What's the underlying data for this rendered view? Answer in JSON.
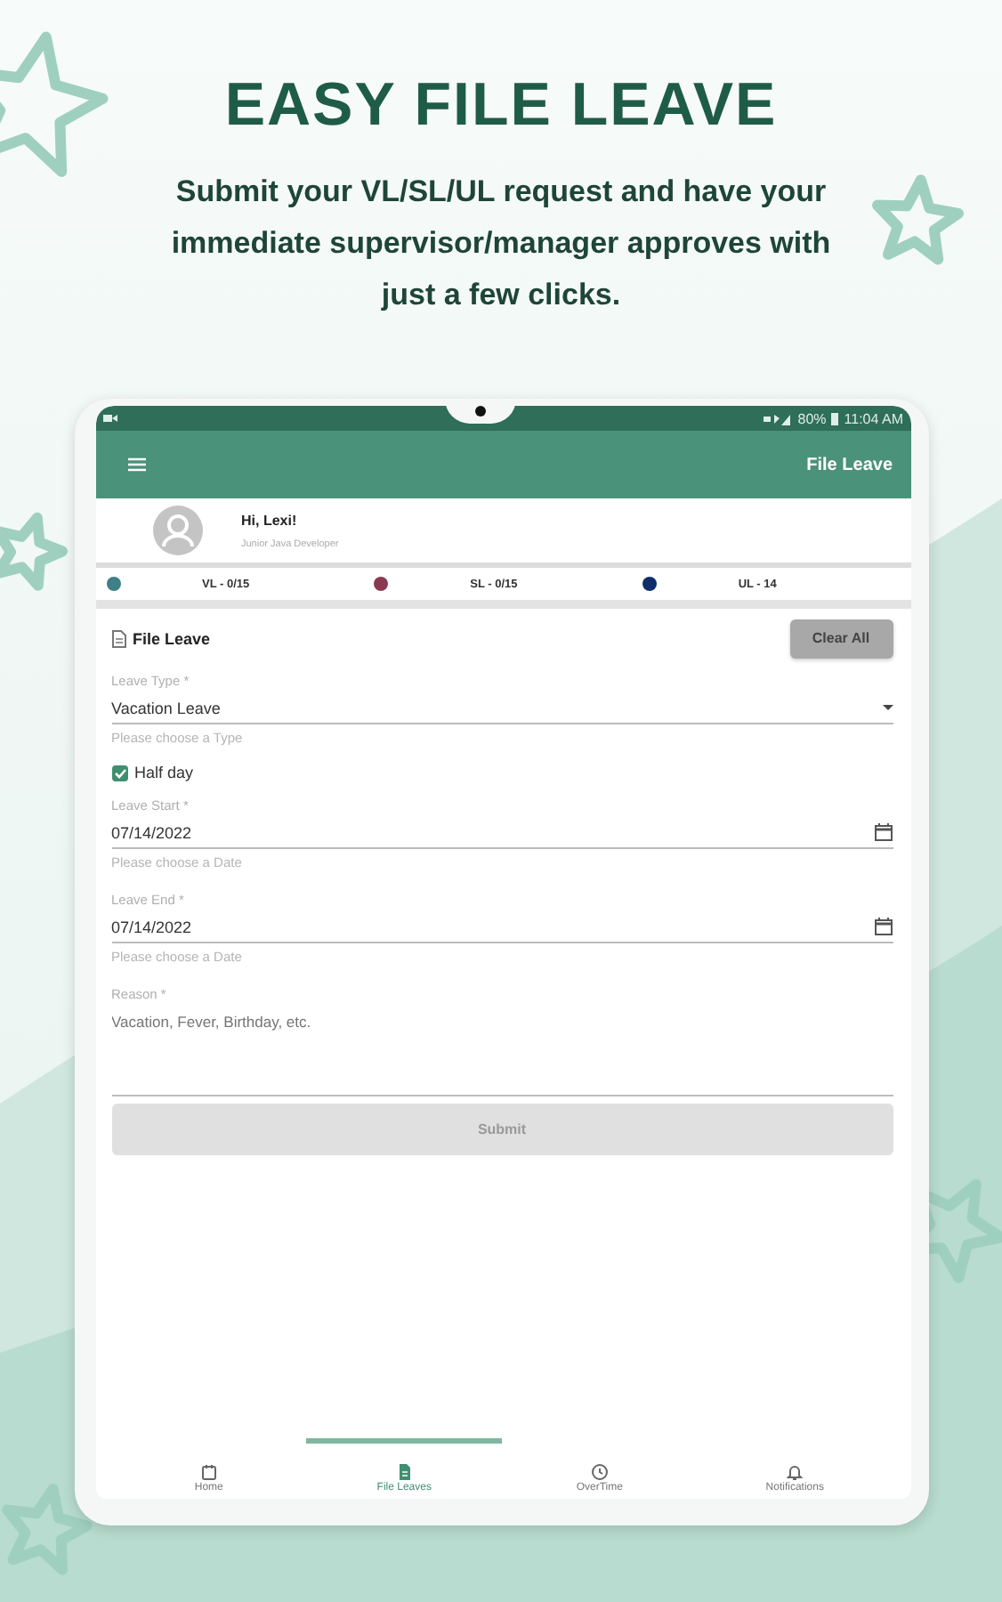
{
  "headline": "EASY FILE LEAVE",
  "subtitle": "Submit your VL/SL/UL request and have your immediate supervisor/manager approves with just a few clicks.",
  "status_bar": {
    "battery": "80%",
    "time": "11:04 AM"
  },
  "app_bar": {
    "title": "File Leave"
  },
  "profile": {
    "greeting": "Hi, Lexi!",
    "role": "Junior Java Developer"
  },
  "balances": [
    {
      "label": "VL - 0/15",
      "color": "#3f7f86"
    },
    {
      "label": "SL - 0/15",
      "color": "#8a3a50"
    },
    {
      "label": "UL - 14",
      "color": "#0d2d6b"
    }
  ],
  "form": {
    "title": "File Leave",
    "clear_button": "Clear All",
    "fields": [
      {
        "kind": "select",
        "label": "Leave Type *",
        "value": "Vacation Leave",
        "hint": "Please choose a Type"
      },
      {
        "kind": "checkbox",
        "label": "Half day",
        "checked": true
      },
      {
        "kind": "date",
        "label": "Leave Start *",
        "value": "07/14/2022",
        "hint": "Please choose a Date"
      },
      {
        "kind": "date",
        "label": "Leave End *",
        "value": "07/14/2022",
        "hint": "Please choose a Date"
      },
      {
        "kind": "textarea",
        "label": "Reason *",
        "placeholder": "Vacation, Fever, Birthday, etc."
      }
    ],
    "submit_button": "Submit",
    "submit_disabled": true
  },
  "bottom_nav": [
    {
      "label": "Home",
      "selected": false
    },
    {
      "label": "File Leaves",
      "selected": true
    },
    {
      "label": "OverTime",
      "selected": false
    },
    {
      "label": "Notifications",
      "selected": false
    }
  ]
}
